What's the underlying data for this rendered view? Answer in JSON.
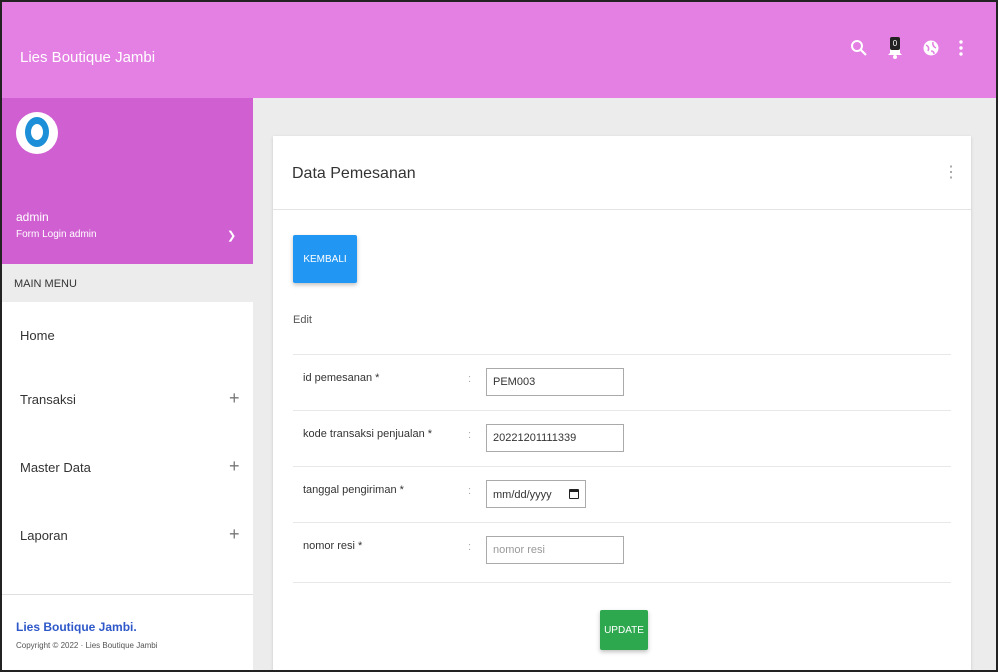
{
  "header": {
    "brand": "Lies Boutique Jambi",
    "notification_count": "0"
  },
  "sidebar": {
    "user_name": "admin",
    "user_role": "Form Login admin",
    "menu_header": "MAIN MENU",
    "items": [
      {
        "label": "Home",
        "expandable": false
      },
      {
        "label": "Transaksi",
        "expandable": true
      },
      {
        "label": "Master Data",
        "expandable": true
      },
      {
        "label": "Laporan",
        "expandable": true
      }
    ],
    "footer_brand": "Lies Boutique Jambi.",
    "footer_copy": "Copyright © 2022 · Lies Boutique Jambi"
  },
  "main": {
    "card_title": "Data Pemesanan",
    "back_button": "KEMBALI",
    "section_label": "Edit",
    "fields": [
      {
        "label": "id pemesanan *",
        "value": "PEM003",
        "placeholder": ""
      },
      {
        "label": "kode transaksi penjualan *",
        "value": "20221201111339",
        "placeholder": ""
      },
      {
        "label": "tanggal pengiriman *",
        "value": "mm/dd/yyyy",
        "placeholder": ""
      },
      {
        "label": "nomor resi *",
        "value": "",
        "placeholder": "nomor resi"
      }
    ],
    "colon": ":",
    "update_button": "UPDATE"
  },
  "colors": {
    "topbar": "#e47fe3",
    "user_block": "#d05fd2",
    "back_button": "#2196f3",
    "update_button": "#2ea84f"
  }
}
